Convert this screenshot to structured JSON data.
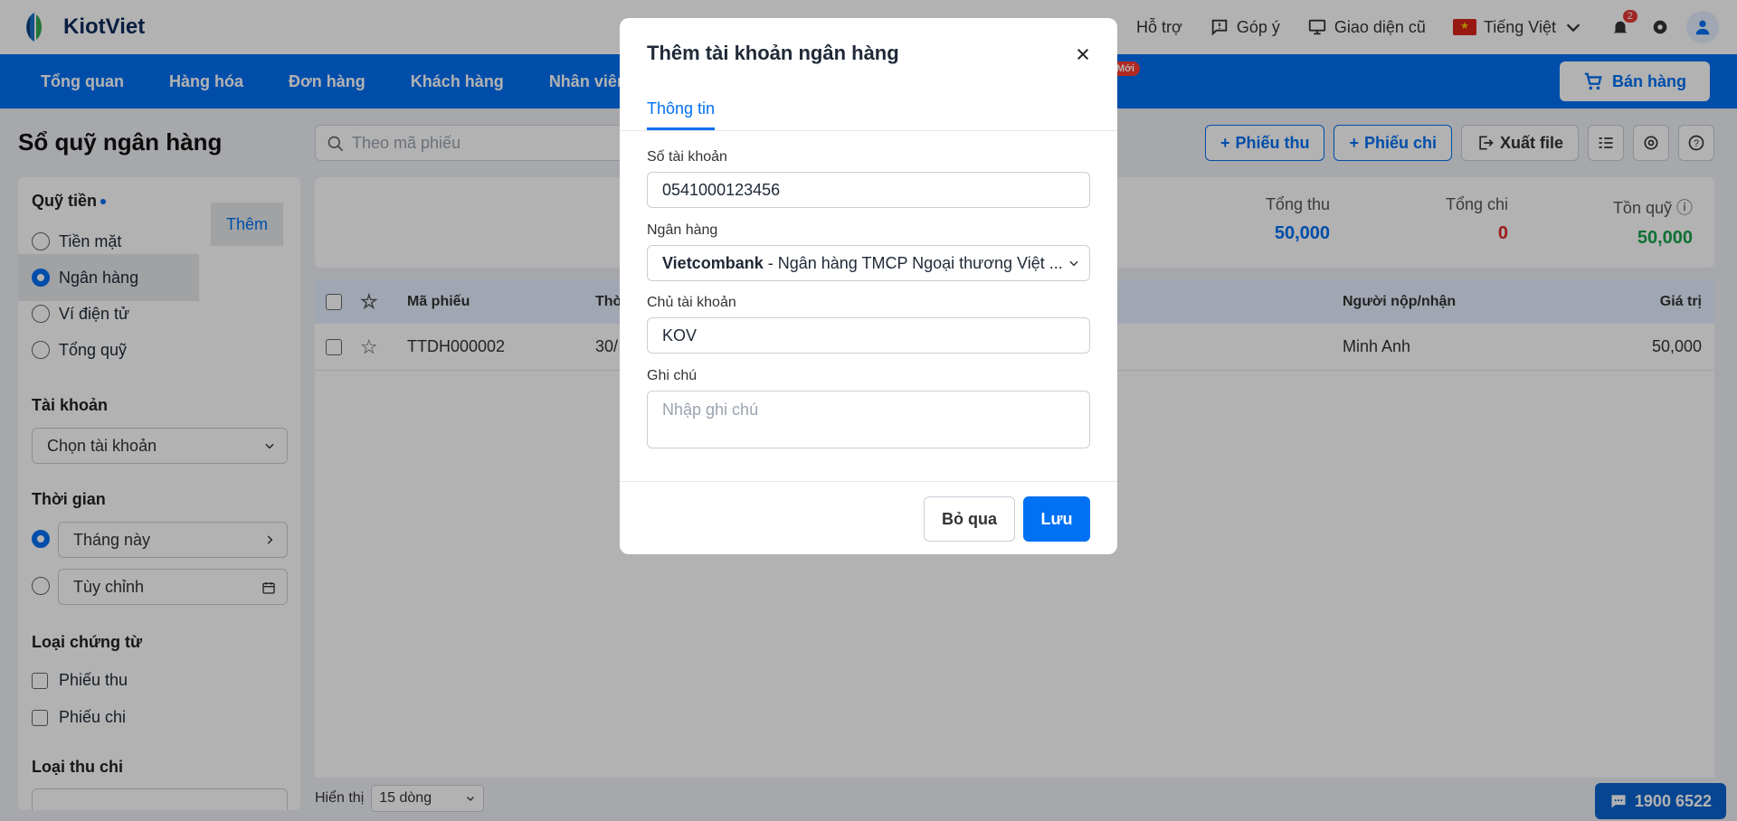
{
  "app": {
    "name": "KiotViet"
  },
  "topbar": {
    "support": "Hỗ trợ",
    "feedback": "Góp ý",
    "old_ui": "Giao diện cũ",
    "language": "Tiếng Việt",
    "notification_count": "2"
  },
  "navbar": {
    "items": [
      "Tổng quan",
      "Hàng hóa",
      "Đơn hàng",
      "Khách hàng",
      "Nhân viên"
    ],
    "new_badge": "Mới",
    "sell_button": "Bán hàng"
  },
  "page": {
    "title": "Sổ quỹ ngân hàng",
    "search_placeholder": "Theo mã phiếu",
    "actions": {
      "receipt": "Phiếu thu",
      "payment": "Phiếu chi",
      "export": "Xuất file"
    }
  },
  "sidebar": {
    "fund_title": "Quỹ tiền",
    "fund_options": [
      "Tiền mặt",
      "Ngân hàng",
      "Ví điện tử",
      "Tổng quỹ"
    ],
    "account_title": "Tài khoản",
    "account_add": "Thêm",
    "account_select": "Chọn tài khoản",
    "time_title": "Thời gian",
    "time_this_month": "Tháng này",
    "time_custom": "Tùy chỉnh",
    "doc_type_title": "Loại chứng từ",
    "doc_types": [
      "Phiếu thu",
      "Phiếu chi"
    ],
    "income_type_title": "Loại thu chi"
  },
  "summary": {
    "total_in_label": "Tổng thu",
    "total_in_value": "50,000",
    "total_out_label": "Tổng chi",
    "total_out_value": "0",
    "balance_label": "Tồn quỹ",
    "balance_value": "50,000"
  },
  "table": {
    "headers": {
      "code": "Mã phiếu",
      "time": "Thời",
      "payer": "Người nộp/nhận",
      "value": "Giá trị"
    },
    "rows": [
      {
        "code": "TTDH000002",
        "time": "30/",
        "payer": "Minh Anh",
        "value": "50,000"
      }
    ]
  },
  "footer": {
    "show_label": "Hiển thị",
    "rows_per_page": "15 dòng",
    "hotline": "1900 6522"
  },
  "modal": {
    "title": "Thêm tài khoản ngân hàng",
    "tab": "Thông tin",
    "account_number_label": "Số tài khoản",
    "account_number_value": "0541000123456",
    "bank_label": "Ngân hàng",
    "bank_name": "Vietcombank",
    "bank_full": " - Ngân hàng TMCP Ngoại thương Việt ...",
    "holder_label": "Chủ tài khoản",
    "holder_value": "KOV",
    "note_label": "Ghi chú",
    "note_placeholder": "Nhập ghi chú",
    "cancel": "Bỏ qua",
    "save": "Lưu"
  },
  "colors": {
    "primary": "#0070f4",
    "income": "#0070f4",
    "expense": "#e02424",
    "balance": "#16a34a"
  }
}
